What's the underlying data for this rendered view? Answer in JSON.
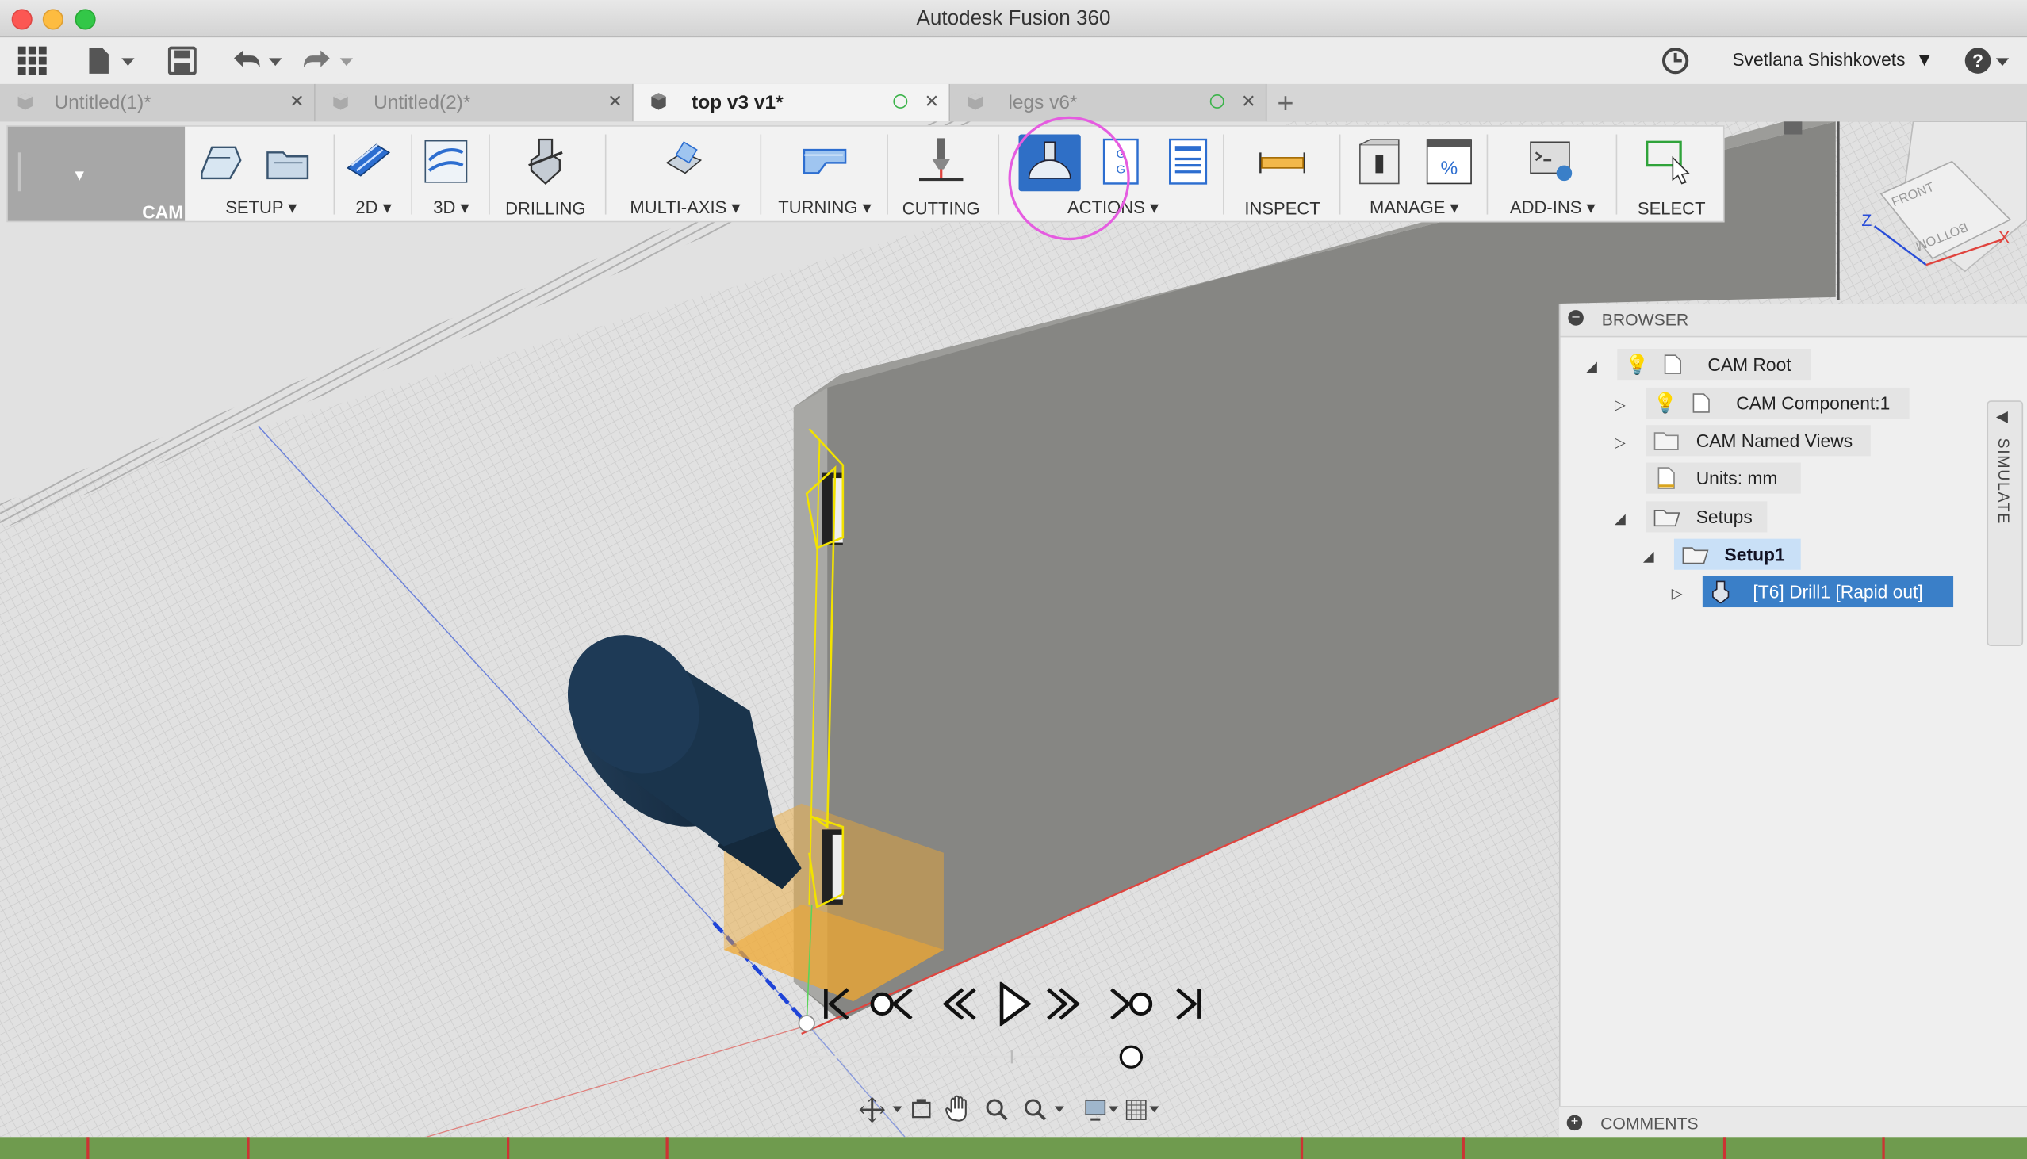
{
  "window": {
    "title": "Autodesk Fusion 360"
  },
  "appbar": {
    "user_name": "Svetlana Shishkovets",
    "icons": [
      "grid-icon",
      "file-icon",
      "save-icon",
      "undo-icon",
      "redo-icon",
      "history-icon",
      "help-icon"
    ]
  },
  "tabs": [
    {
      "label": "Untitled(1)*",
      "active": false,
      "close": "×"
    },
    {
      "label": "Untitled(2)*",
      "active": false,
      "close": "×"
    },
    {
      "label": "top v3 v1*",
      "active": true,
      "close": "×"
    },
    {
      "label": "legs v6*",
      "active": false,
      "close": "×"
    }
  ],
  "tab_add": "+",
  "ribbon": {
    "workspace": "CAM",
    "groups": {
      "setup": "SETUP",
      "two_d": "2D",
      "three_d": "3D",
      "drilling": "DRILLING",
      "multi_axis": "MULTI-AXIS",
      "turning": "TURNING",
      "cutting": "CUTTING",
      "actions": "ACTIONS",
      "inspect": "INSPECT",
      "manage": "MANAGE",
      "add_ins": "ADD-INS",
      "select": "SELECT"
    },
    "highlight_color": "#e55ce0"
  },
  "browser": {
    "title": "BROWSER",
    "nodes": {
      "cam_root": "CAM Root",
      "cam_component": "CAM Component:1",
      "named_views": "CAM Named Views",
      "units": "Units: mm",
      "setups": "Setups",
      "setup1": "Setup1",
      "operation": "[T6] Drill1 [Rapid out]"
    },
    "selected_color": "#3a7fc8"
  },
  "simulate_tab": "SIMULATE",
  "comments": {
    "title": "COMMENTS"
  },
  "viewcube": {
    "front": "FRONT",
    "bottom": "BOTTOM",
    "axes": [
      "Z",
      "X"
    ]
  },
  "playback": {
    "buttons": [
      "skip-start",
      "step-back-operation",
      "step-back",
      "play",
      "step-forward",
      "step-forward-operation",
      "skip-end"
    ],
    "progress": 0.78
  },
  "colors": {
    "status_bar": "#6f9b4e",
    "toolpath": "#f2e200",
    "stock": "#f0a830"
  }
}
